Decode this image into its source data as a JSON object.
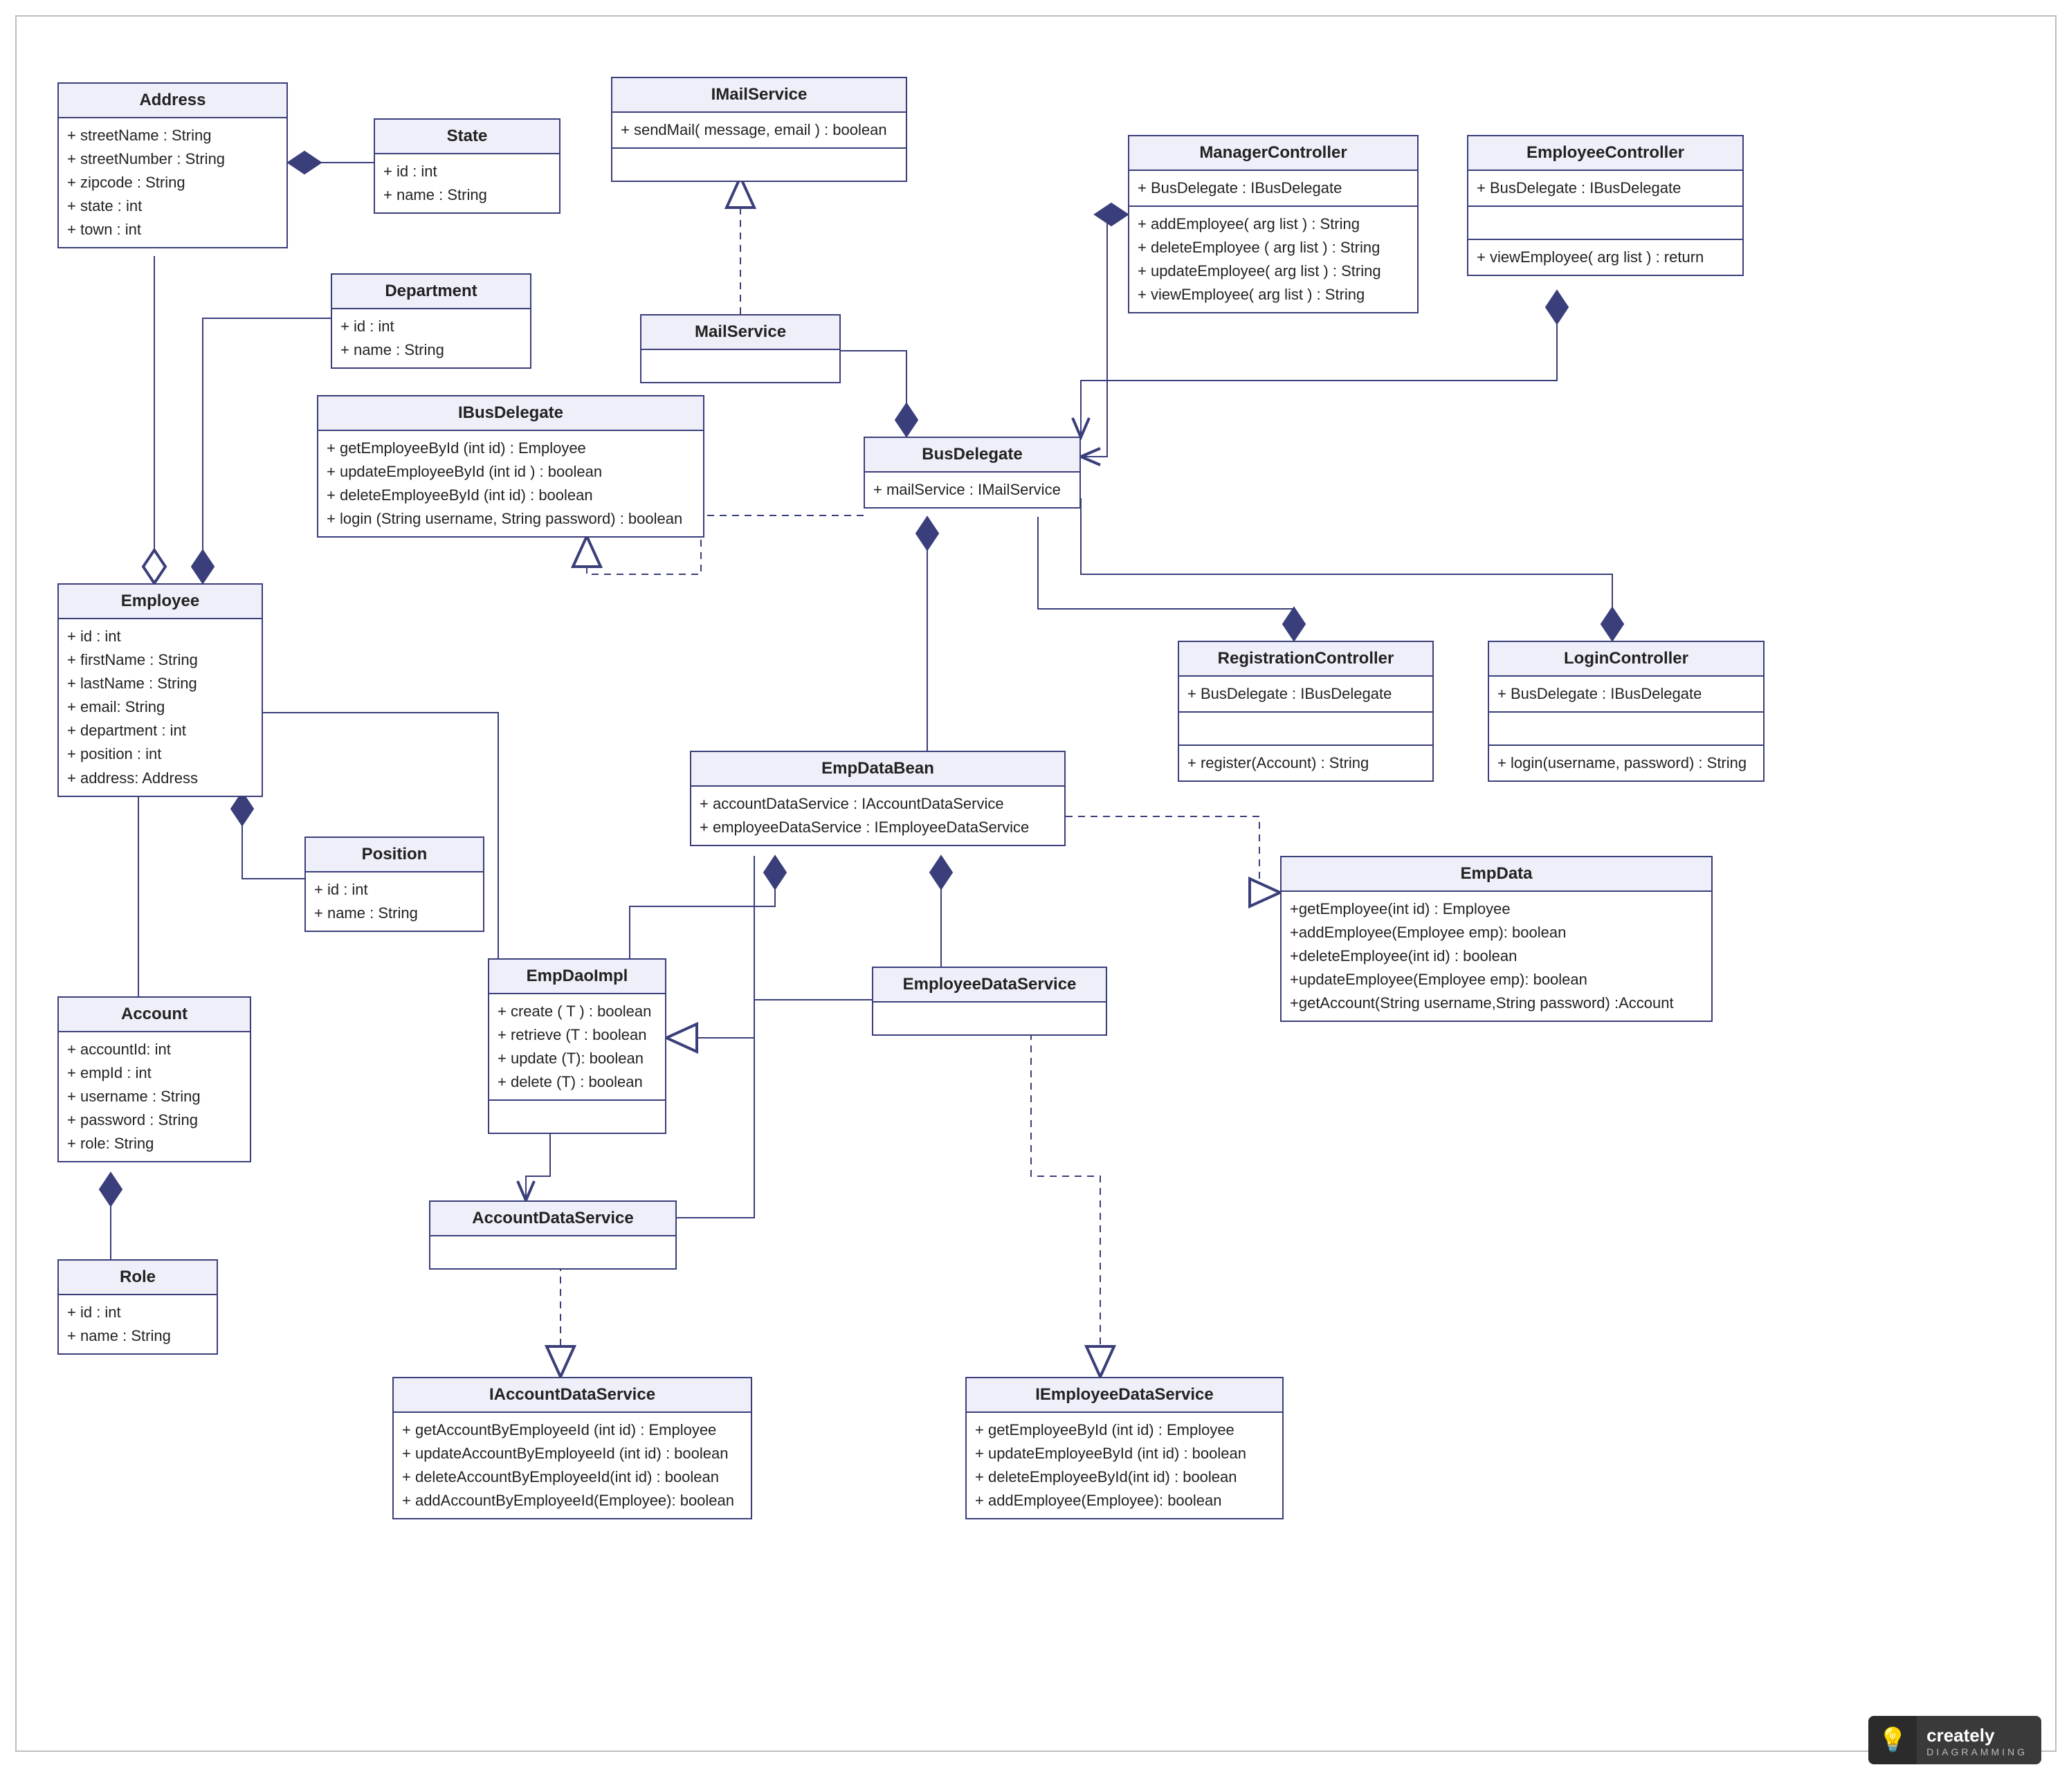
{
  "classes": {
    "Address": {
      "name": "Address",
      "attrs": [
        "+ streetName : String",
        "+ streetNumber : String",
        "+ zipcode : String",
        "+ state : int",
        "+ town : int"
      ]
    },
    "State": {
      "name": "State",
      "attrs": [
        "+ id : int",
        "+ name : String"
      ]
    },
    "Department": {
      "name": "Department",
      "attrs": [
        "+ id : int",
        "+ name : String"
      ]
    },
    "Employee": {
      "name": "Employee",
      "attrs": [
        "+ id : int",
        "+ firstName : String",
        "+ lastName : String",
        "+ email: String",
        "+ department : int",
        "+ position : int",
        "+ address: Address"
      ]
    },
    "Position": {
      "name": "Position",
      "attrs": [
        "+ id : int",
        "+ name : String"
      ]
    },
    "Account": {
      "name": "Account",
      "attrs": [
        "+ accountId: int",
        "+ empId : int",
        "+ username : String",
        "+ password : String",
        "+ role: String"
      ]
    },
    "Role": {
      "name": "Role",
      "attrs": [
        "+ id : int",
        "+ name : String"
      ]
    },
    "IMailService": {
      "name": "IMailService",
      "ops": [
        "+ sendMail( message, email ) :   boolean"
      ]
    },
    "MailService": {
      "name": "MailService"
    },
    "IBusDelegate": {
      "name": "IBusDelegate",
      "ops": [
        "+ getEmployeeById (int id) : Employee",
        "+ updateEmployeeById (int id ) : boolean",
        "+ deleteEmployeeById (int id) : boolean",
        "+ login (String username, String password) : boolean"
      ]
    },
    "BusDelegate": {
      "name": "BusDelegate",
      "attrs": [
        "+ mailService : IMailService"
      ]
    },
    "ManagerController": {
      "name": "ManagerController",
      "attrs": [
        "+ BusDelegate : IBusDelegate"
      ],
      "ops": [
        "+  addEmployee( arg list ) : String",
        "+ deleteEmployee ( arg list ) : String",
        "+ updateEmployee( arg list ) : String",
        "+ viewEmployee( arg list ) : String"
      ]
    },
    "EmployeeController": {
      "name": "EmployeeController",
      "attrs": [
        "+ BusDelegate : IBusDelegate"
      ],
      "ops": [
        "+ viewEmployee( arg list ) :  return"
      ]
    },
    "RegistrationController": {
      "name": "RegistrationController",
      "attrs": [
        "+ BusDelegate : IBusDelegate"
      ],
      "ops": [
        "+ register(Account) : String"
      ]
    },
    "LoginController": {
      "name": "LoginController",
      "attrs": [
        "+ BusDelegate : IBusDelegate"
      ],
      "ops": [
        "+ login(username, password) : String"
      ]
    },
    "EmpDataBean": {
      "name": "EmpDataBean",
      "attrs": [
        "+ accountDataService : IAccountDataService",
        "+ employeeDataService : IEmployeeDataService"
      ]
    },
    "EmpDaoImpl": {
      "name": "EmpDaoImpl",
      "ops": [
        "+ create (  T ) : boolean",
        "+ retrieve (T :  boolean",
        "+ update (T): boolean",
        "+ delete (T) : boolean"
      ]
    },
    "AccountDataService": {
      "name": "AccountDataService"
    },
    "EmployeeDataService": {
      "name": "EmployeeDataService"
    },
    "EmpData": {
      "name": "EmpData",
      "ops": [
        "+getEmployee(int id) : Employee",
        "+addEmployee(Employee emp): boolean",
        "+deleteEmployee(int id) : boolean",
        "+updateEmployee(Employee emp): boolean",
        "+getAccount(String username,String password) :Account"
      ]
    },
    "IAccountDataService": {
      "name": "IAccountDataService",
      "ops": [
        "+ getAccountByEmployeeId (int id) : Employee",
        "+ updateAccountByEmployeeId (int id) : boolean",
        "+ deleteAccountByEmployeeId(int id) : boolean",
        "+ addAccountByEmployeeId(Employee): boolean"
      ]
    },
    "IEmployeeDataService": {
      "name": "IEmployeeDataService",
      "ops": [
        "+ getEmployeeById (int id) : Employee",
        "+ updateEmployeeById (int id) : boolean",
        "+ deleteEmployeeById(int id) : boolean",
        "+ addEmployee(Employee): boolean"
      ]
    }
  },
  "logo": {
    "brand": "creately",
    "tag": "DIAGRAMMING"
  }
}
